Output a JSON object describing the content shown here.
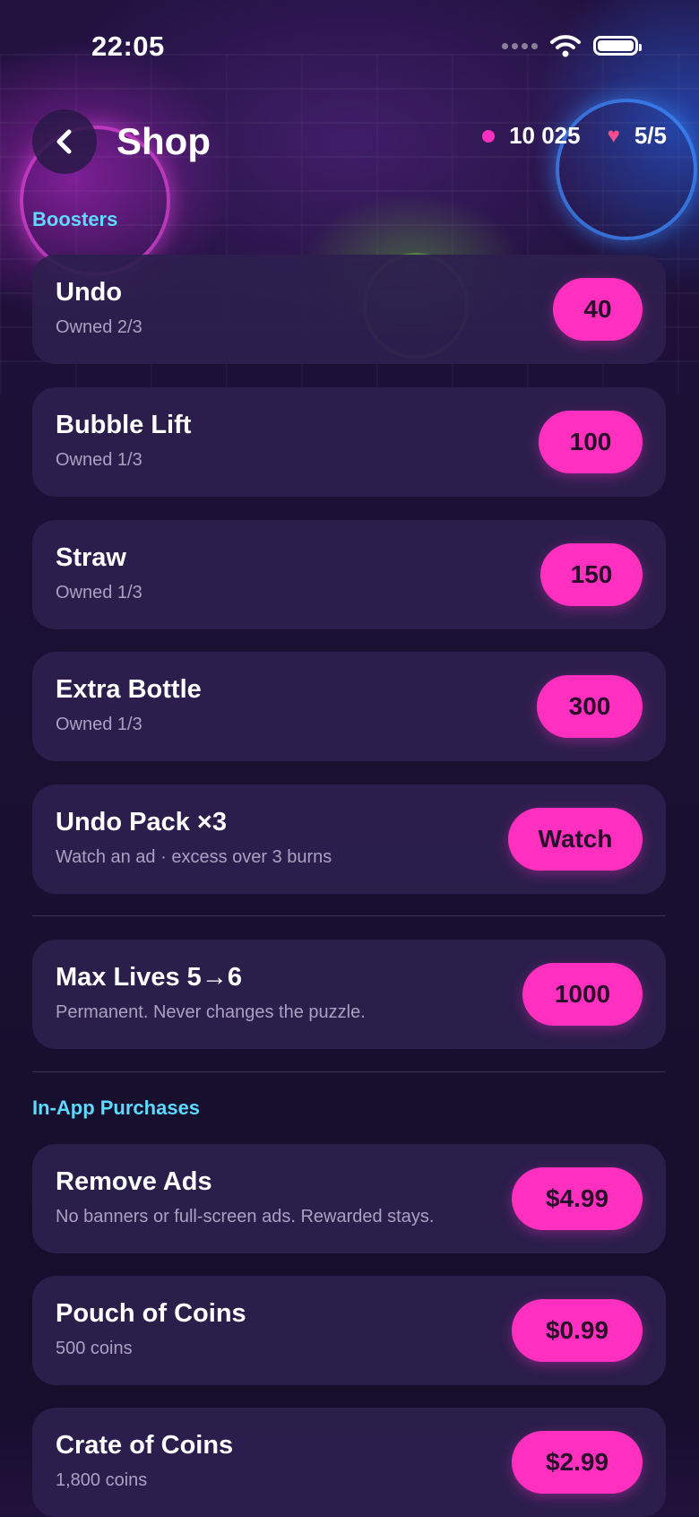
{
  "status_bar": {
    "time": "22:05"
  },
  "header": {
    "title": "Shop",
    "coins": "10 025",
    "lives": "5/5"
  },
  "sections": {
    "boosters_label": "Boosters",
    "iap_label": "In-App Purchases"
  },
  "boosters": [
    {
      "title": "Undo",
      "subtitle": "Owned 2/3",
      "price": "40"
    },
    {
      "title": "Bubble Lift",
      "subtitle": "Owned 1/3",
      "price": "100"
    },
    {
      "title": "Straw",
      "subtitle": "Owned 1/3",
      "price": "150"
    },
    {
      "title": "Extra Bottle",
      "subtitle": "Owned 1/3",
      "price": "300"
    },
    {
      "title": "Undo Pack ×3",
      "subtitle": "Watch an ad · excess over 3 burns",
      "price": "Watch"
    }
  ],
  "upgrade": {
    "title": "Max Lives 5→6",
    "subtitle": "Permanent. Never changes the puzzle.",
    "price": "1000"
  },
  "iap": [
    {
      "title": "Remove Ads",
      "subtitle": "No banners or full-screen ads. Rewarded stays.",
      "price": "$4.99"
    },
    {
      "title": "Pouch of Coins",
      "subtitle": "500 coins",
      "price": "$0.99"
    },
    {
      "title": "Crate of Coins",
      "subtitle": "1,800 coins",
      "price": "$2.99"
    }
  ],
  "colors": {
    "accent_pink": "#ff2fbf",
    "section_label": "#5fd9ff",
    "card_bg": "#2c204e"
  },
  "icons": {
    "back": "chevron-left-icon",
    "coin": "coin-dot-icon",
    "life": "heart-icon",
    "wifi": "wifi-icon",
    "battery": "battery-icon"
  }
}
